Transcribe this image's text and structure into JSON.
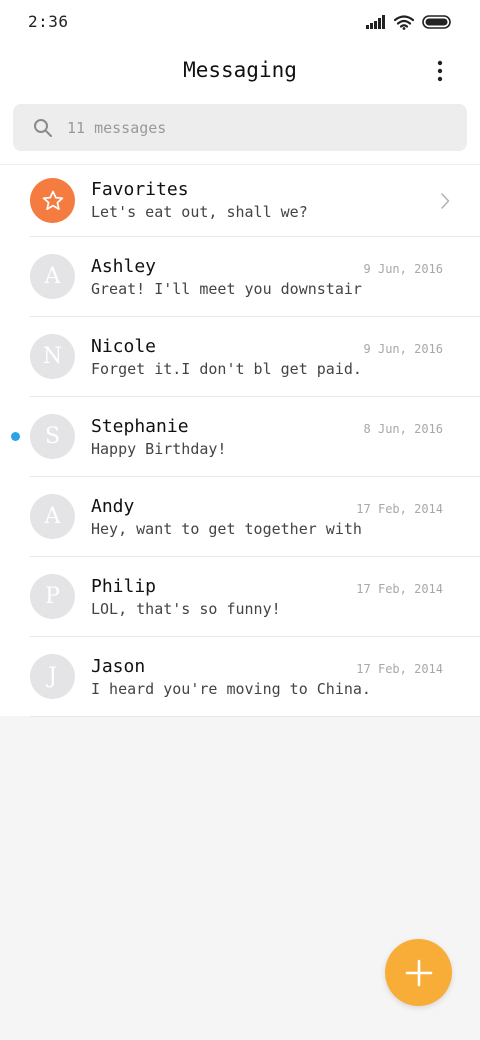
{
  "status_bar": {
    "time": "2:36"
  },
  "header": {
    "title": "Messaging"
  },
  "search": {
    "placeholder": "11 messages"
  },
  "favorites": {
    "name": "Favorites",
    "preview": "Let's eat out, shall we?"
  },
  "conversations": [
    {
      "initial": "A",
      "name": "Ashley",
      "date": "9 Jun, 2016",
      "preview": "Great! I'll meet you downstair",
      "unread": false
    },
    {
      "initial": "N",
      "name": "Nicole",
      "date": "9 Jun, 2016",
      "preview": "Forget it.I don't bl get paid.",
      "unread": false
    },
    {
      "initial": "S",
      "name": "Stephanie",
      "date": "8 Jun, 2016",
      "preview": "Happy Birthday!",
      "unread": true
    },
    {
      "initial": "A",
      "name": "Andy",
      "date": "17 Feb, 2014",
      "preview": "Hey, want to get together with",
      "unread": false
    },
    {
      "initial": "P",
      "name": "Philip",
      "date": "17 Feb, 2014",
      "preview": "LOL, that's so funny!",
      "unread": false
    },
    {
      "initial": "J",
      "name": "Jason",
      "date": "17 Feb, 2014",
      "preview": "I heard you're moving to China.",
      "unread": false
    }
  ],
  "colors": {
    "favorites_avatar": "#f47c40",
    "fab": "#f8ad38",
    "unread_dot": "#2aa3e8",
    "avatar_placeholder": "#e4e4e6"
  },
  "icons": {
    "signal": "signal-icon",
    "wifi": "wifi-icon",
    "battery": "battery-icon",
    "more": "more-vertical-icon",
    "search": "search-icon",
    "favorites": "star-icon",
    "chevron": "chevron-right-icon",
    "compose": "plus-icon"
  }
}
